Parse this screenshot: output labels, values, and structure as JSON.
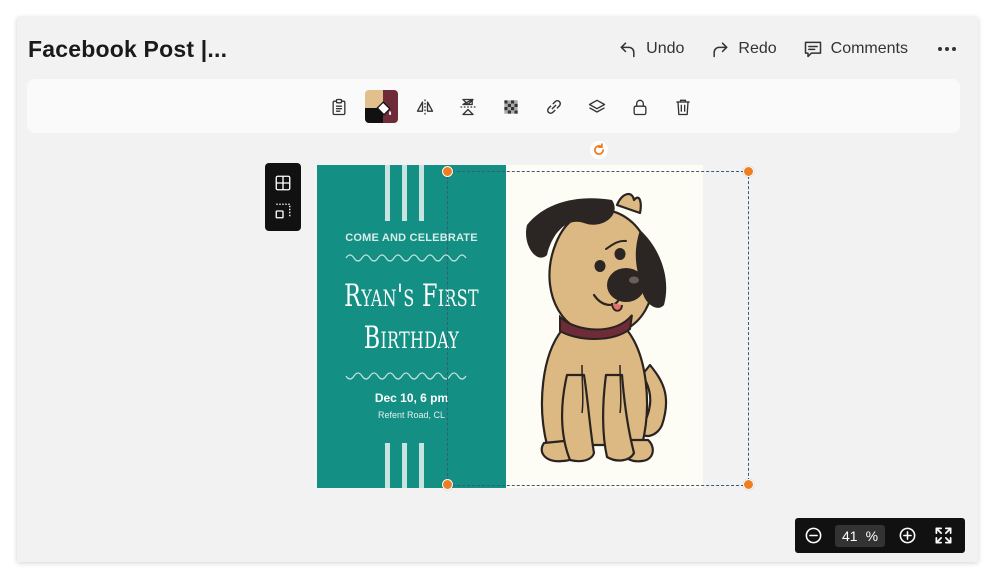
{
  "header": {
    "title": "Facebook Post |...",
    "undo_label": "Undo",
    "redo_label": "Redo",
    "comments_label": "Comments",
    "more_icon": "more-icon"
  },
  "toolbar": {
    "items": [
      "clipboard-icon",
      "color-fill-icon",
      "flip-horizontal-icon",
      "flip-vertical-icon",
      "transparency-icon",
      "link-icon",
      "layers-icon",
      "lock-icon",
      "delete-icon"
    ],
    "swatch_colors": [
      "#e2c08d",
      "#6e2b38",
      "#111111"
    ]
  },
  "side_tools": [
    "grid-icon",
    "crop-select-icon"
  ],
  "card": {
    "background": "#fdfdf5",
    "panel_color": "#138f83",
    "headline": "COME AND CELEBRATE",
    "name_line1": "Ryan's First",
    "name_line2": "Birthday",
    "date": "Dec 10, 6 pm",
    "address": "Refent Road, CL",
    "image": "cartoon-dog"
  },
  "selection": {
    "handle_color": "#ef7d22",
    "rotate_icon": "rotate-icon"
  },
  "zoom": {
    "value": "41",
    "unit": "%",
    "zoom_out_icon": "zoom-out-icon",
    "zoom_in_icon": "zoom-in-icon",
    "fit_icon": "fit-screen-icon"
  }
}
